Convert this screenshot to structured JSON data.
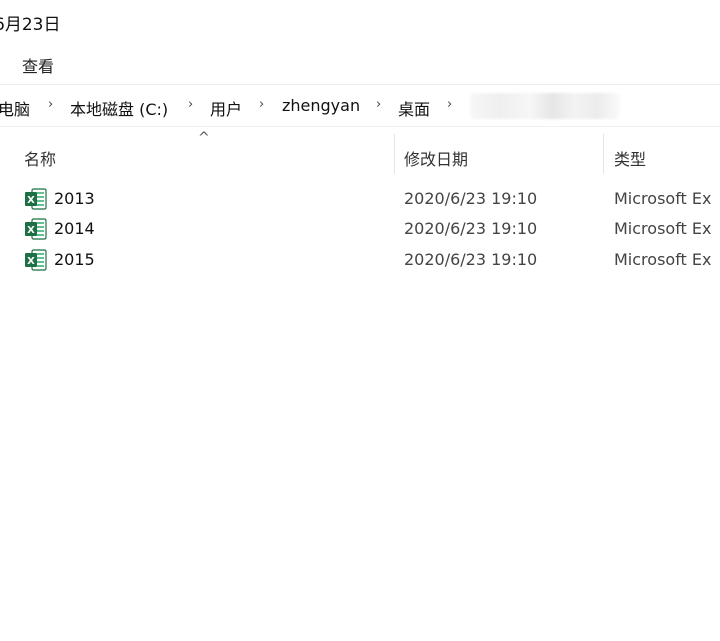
{
  "window": {
    "title_fragment": "6月23日"
  },
  "ribbon": {
    "view_tab": "查看"
  },
  "breadcrumb": {
    "items": [
      "电脑",
      "本地磁盘 (C:)",
      "用户",
      "zhengyan",
      "桌面"
    ],
    "separator": "›"
  },
  "columns": {
    "name": "名称",
    "date_modified": "修改日期",
    "type": "类型",
    "sort_indicator": "^"
  },
  "files": [
    {
      "name": "2013",
      "date": "2020/6/23 19:10",
      "type": "Microsoft Ex",
      "icon": "excel-file-icon"
    },
    {
      "name": "2014",
      "date": "2020/6/23 19:10",
      "type": "Microsoft Ex",
      "icon": "excel-file-icon"
    },
    {
      "name": "2015",
      "date": "2020/6/23 19:10",
      "type": "Microsoft Ex",
      "icon": "excel-file-icon"
    }
  ],
  "colors": {
    "excel_green": "#1d7044",
    "excel_light": "#21a366"
  }
}
